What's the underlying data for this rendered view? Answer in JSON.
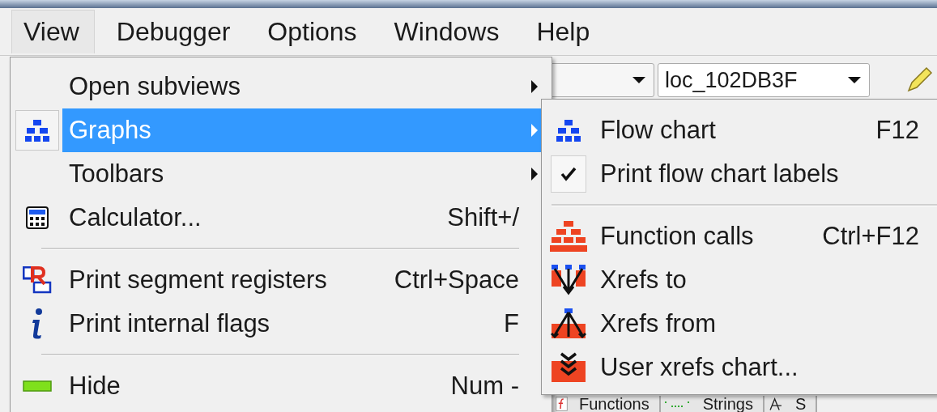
{
  "menubar": [
    {
      "label": "View",
      "selected": true
    },
    {
      "label": "Debugger",
      "selected": false
    },
    {
      "label": "Options",
      "selected": false
    },
    {
      "label": "Windows",
      "selected": false
    },
    {
      "label": "Help",
      "selected": false
    }
  ],
  "toolbar": {
    "location_combo": {
      "value": "loc_102DB3F"
    }
  },
  "menu": {
    "items": [
      {
        "kind": "submenu",
        "label": "Open subviews",
        "selected": false
      },
      {
        "kind": "submenu",
        "label": "Graphs",
        "selected": true
      },
      {
        "kind": "submenu",
        "label": "Toolbars",
        "selected": false
      },
      {
        "kind": "command",
        "label": "Calculator...",
        "shortcut": "Shift+/",
        "selected": false
      },
      {
        "kind": "separator"
      },
      {
        "kind": "command",
        "label": "Print segment registers",
        "shortcut": "Ctrl+Space",
        "selected": false
      },
      {
        "kind": "command",
        "label": "Print internal flags",
        "shortcut": "F",
        "selected": false
      },
      {
        "kind": "separator"
      },
      {
        "kind": "command",
        "label": "Hide",
        "shortcut": "Num -",
        "selected": false
      }
    ]
  },
  "submenu": {
    "items": [
      {
        "kind": "command",
        "label": "Flow chart",
        "shortcut": "F12"
      },
      {
        "kind": "check",
        "label": "Print flow chart labels",
        "checked": true
      },
      {
        "kind": "separator"
      },
      {
        "kind": "command",
        "label": "Function calls",
        "shortcut": "Ctrl+F12"
      },
      {
        "kind": "command",
        "label": "Xrefs to"
      },
      {
        "kind": "command",
        "label": "Xrefs from"
      },
      {
        "kind": "command",
        "label": "User xrefs chart..."
      }
    ]
  },
  "tabs": [
    {
      "label": "Functions"
    },
    {
      "label": "Strings"
    },
    {
      "label": "S"
    }
  ]
}
